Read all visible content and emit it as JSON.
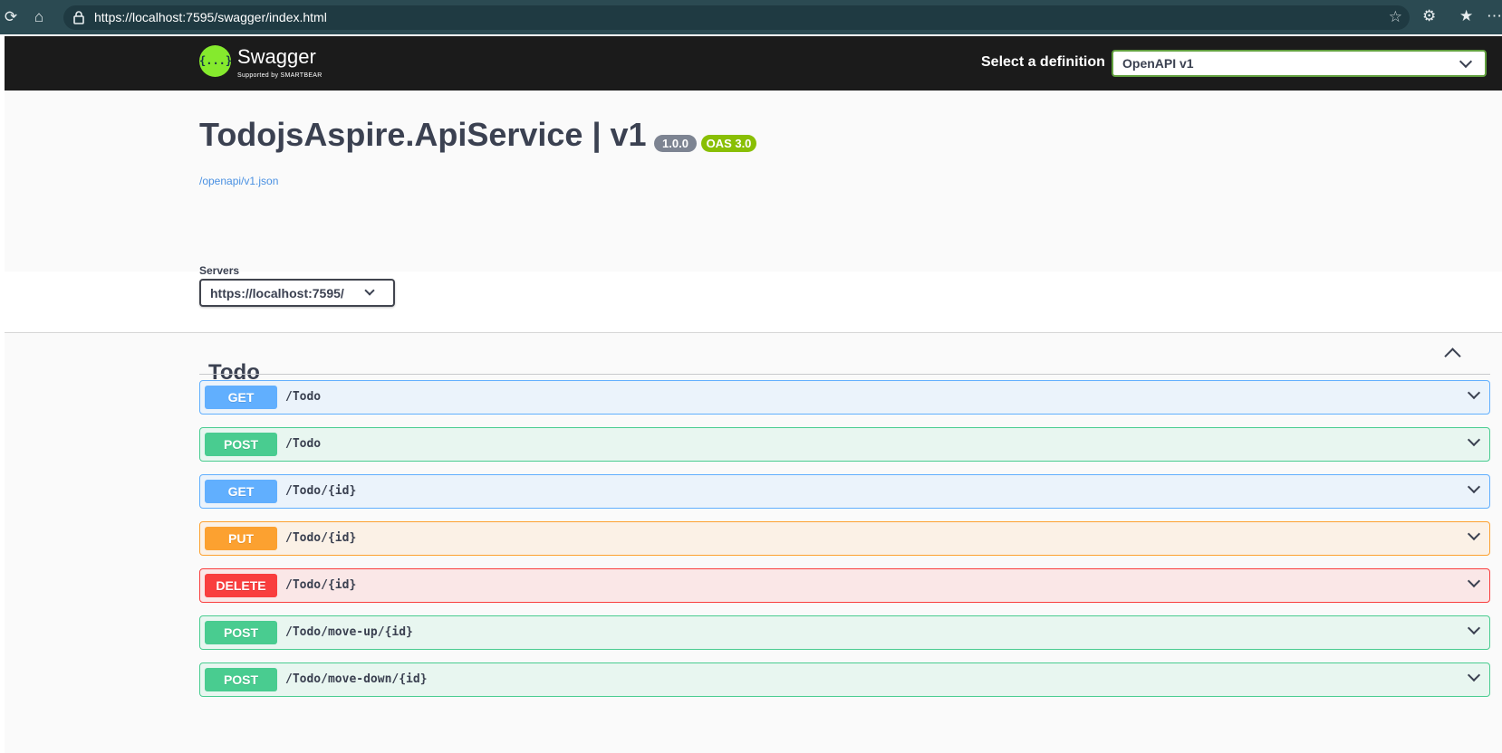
{
  "browser": {
    "url": "https://localhost:7595/swagger/index.html"
  },
  "topbar": {
    "logo_glyph": "{...}",
    "logo_text": "Swagger",
    "logo_subtext": "Supported by SMARTBEAR",
    "definition_label": "Select a definition",
    "definition_value": "OpenAPI v1"
  },
  "info": {
    "title": "TodojsAspire.ApiService | v1",
    "version_badge": "1.0.0",
    "oas_badge": "OAS 3.0",
    "spec_link": "/openapi/v1.json"
  },
  "servers": {
    "label": "Servers",
    "value": "https://localhost:7595/"
  },
  "tag": {
    "name": "Todo",
    "expanded": true
  },
  "operations": [
    {
      "method": "GET",
      "path": "/Todo"
    },
    {
      "method": "POST",
      "path": "/Todo"
    },
    {
      "method": "GET",
      "path": "/Todo/{id}"
    },
    {
      "method": "PUT",
      "path": "/Todo/{id}"
    },
    {
      "method": "DELETE",
      "path": "/Todo/{id}"
    },
    {
      "method": "POST",
      "path": "/Todo/move-up/{id}"
    },
    {
      "method": "POST",
      "path": "/Todo/move-down/{id}"
    }
  ],
  "colors": {
    "get": "#61affe",
    "post": "#49cc90",
    "put": "#fca130",
    "delete": "#f93e3e",
    "logo_green": "#85ea2d",
    "topbar_bg": "#1b1b1b"
  }
}
